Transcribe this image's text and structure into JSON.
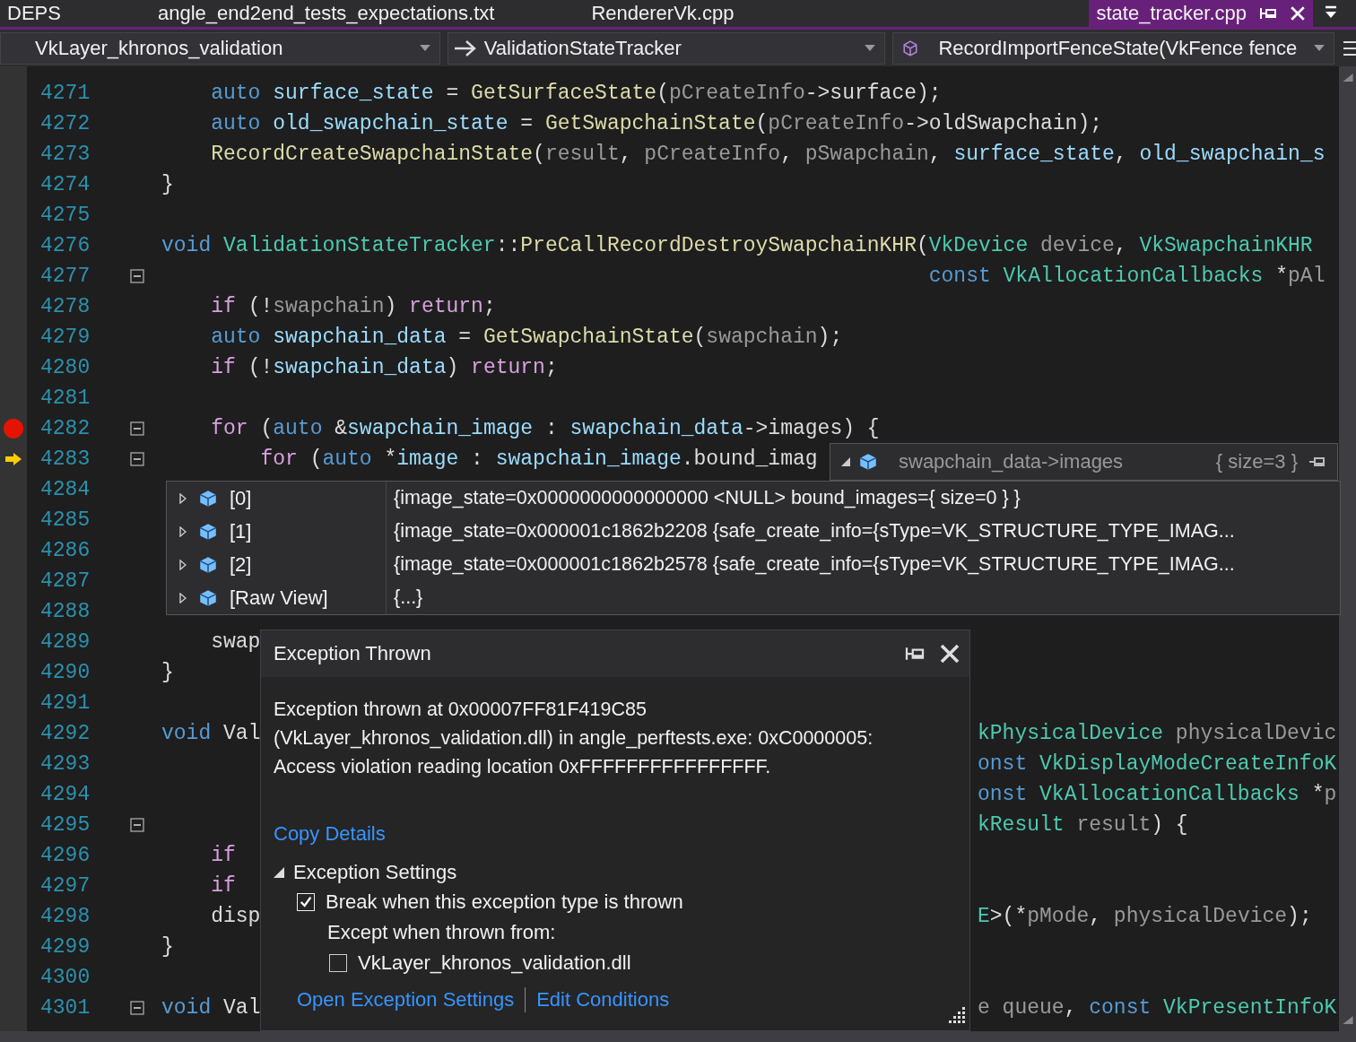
{
  "tabs": [
    {
      "label": "DEPS",
      "selected": false
    },
    {
      "label": "angle_end2end_tests_expectations.txt",
      "selected": false
    },
    {
      "label": "RendererVk.cpp",
      "selected": false
    },
    {
      "label": "state_tracker.cpp",
      "selected": true
    }
  ],
  "navigation": {
    "project": "VkLayer_khronos_validation",
    "scope": "ValidationStateTracker",
    "member": "RecordImportFenceState(VkFence fence"
  },
  "code_lines": [
    {
      "number": "4271",
      "fold": false,
      "code": [
        {
          "kind": "k",
          "text": "    auto"
        },
        {
          "kind": "v",
          "text": " surface_state"
        },
        {
          "kind": "o",
          "text": " = "
        },
        {
          "kind": "f",
          "text": "GetSurfaceState"
        },
        {
          "kind": "o",
          "text": "("
        },
        {
          "kind": "p",
          "text": "pCreateInfo"
        },
        {
          "kind": "o",
          "text": "->surface);"
        }
      ]
    },
    {
      "number": "4272",
      "fold": false,
      "code": [
        {
          "kind": "k",
          "text": "    auto"
        },
        {
          "kind": "v",
          "text": " old_swapchain_state"
        },
        {
          "kind": "o",
          "text": " = "
        },
        {
          "kind": "f",
          "text": "GetSwapchainState"
        },
        {
          "kind": "o",
          "text": "("
        },
        {
          "kind": "p",
          "text": "pCreateInfo"
        },
        {
          "kind": "o",
          "text": "->oldSwapchain);"
        }
      ]
    },
    {
      "number": "4273",
      "fold": false,
      "code": [
        {
          "kind": "f",
          "text": "    RecordCreateSwapchainState"
        },
        {
          "kind": "o",
          "text": "("
        },
        {
          "kind": "p",
          "text": "result"
        },
        {
          "kind": "o",
          "text": ", "
        },
        {
          "kind": "p",
          "text": "pCreateInfo"
        },
        {
          "kind": "o",
          "text": ", "
        },
        {
          "kind": "p",
          "text": "pSwapchain"
        },
        {
          "kind": "o",
          "text": ", "
        },
        {
          "kind": "v",
          "text": "surface_state"
        },
        {
          "kind": "o",
          "text": ", "
        },
        {
          "kind": "v",
          "text": "old_swapchain_s"
        }
      ]
    },
    {
      "number": "4274",
      "fold": false,
      "code": [
        {
          "kind": "o",
          "text": "}"
        }
      ]
    },
    {
      "number": "4275",
      "fold": false
    },
    {
      "number": "4276",
      "fold": false,
      "code": [
        {
          "kind": "k",
          "text": "void"
        },
        {
          "kind": "t",
          "text": " ValidationStateTracker"
        },
        {
          "kind": "o",
          "text": "::"
        },
        {
          "kind": "f",
          "text": "PreCallRecordDestroySwapchainKHR"
        },
        {
          "kind": "o",
          "text": "("
        },
        {
          "kind": "t",
          "text": "VkDevice"
        },
        {
          "kind": "p",
          "text": " device"
        },
        {
          "kind": "o",
          "text": ", "
        },
        {
          "kind": "t",
          "text": "VkSwapchainKHR"
        }
      ]
    },
    {
      "number": "4277",
      "fold": true,
      "code": [
        {
          "kind": "k",
          "text": "                                                              const"
        },
        {
          "kind": "t",
          "text": " VkAllocationCallbacks"
        },
        {
          "kind": "o",
          "text": " *"
        },
        {
          "kind": "p",
          "text": "pAl"
        }
      ]
    },
    {
      "number": "4278",
      "fold": false,
      "code": [
        {
          "kind": "c",
          "text": "    if"
        },
        {
          "kind": "o",
          "text": " (!"
        },
        {
          "kind": "p",
          "text": "swapchain"
        },
        {
          "kind": "o",
          "text": ") "
        },
        {
          "kind": "c",
          "text": "return"
        },
        {
          "kind": "o",
          "text": ";"
        }
      ]
    },
    {
      "number": "4279",
      "fold": false,
      "code": [
        {
          "kind": "k",
          "text": "    auto"
        },
        {
          "kind": "v",
          "text": " swapchain_data"
        },
        {
          "kind": "o",
          "text": " = "
        },
        {
          "kind": "f",
          "text": "GetSwapchainState"
        },
        {
          "kind": "o",
          "text": "("
        },
        {
          "kind": "p",
          "text": "swapchain"
        },
        {
          "kind": "o",
          "text": ");"
        }
      ]
    },
    {
      "number": "4280",
      "fold": false,
      "code": [
        {
          "kind": "c",
          "text": "    if"
        },
        {
          "kind": "o",
          "text": " (!"
        },
        {
          "kind": "v",
          "text": "swapchain_data"
        },
        {
          "kind": "o",
          "text": ") "
        },
        {
          "kind": "c",
          "text": "return"
        },
        {
          "kind": "o",
          "text": ";"
        }
      ]
    },
    {
      "number": "4281",
      "fold": false
    },
    {
      "number": "4282",
      "fold": true,
      "breakpoint": true,
      "code": [
        {
          "kind": "c",
          "text": "    for"
        },
        {
          "kind": "o",
          "text": " ("
        },
        {
          "kind": "k",
          "text": "auto"
        },
        {
          "kind": "o",
          "text": " &"
        },
        {
          "kind": "v",
          "text": "swapchain_image"
        },
        {
          "kind": "o",
          "text": " : "
        },
        {
          "kind": "v",
          "text": "swapchain_data"
        },
        {
          "kind": "o",
          "text": "->images) {"
        }
      ]
    },
    {
      "number": "4283",
      "fold": true,
      "current": true,
      "code": [
        {
          "kind": "c",
          "text": "        for"
        },
        {
          "kind": "o",
          "text": " ("
        },
        {
          "kind": "k",
          "text": "auto"
        },
        {
          "kind": "o",
          "text": " *"
        },
        {
          "kind": "v",
          "text": "image"
        },
        {
          "kind": "o",
          "text": " : "
        },
        {
          "kind": "v",
          "text": "swapchain_image"
        },
        {
          "kind": "o",
          "text": ".bound_imag"
        }
      ]
    },
    {
      "number": "4284",
      "fold": false
    },
    {
      "number": "4285",
      "fold": false
    },
    {
      "number": "4286",
      "fold": false
    },
    {
      "number": "4287",
      "fold": false
    },
    {
      "number": "4288",
      "fold": false
    },
    {
      "number": "4289",
      "fold": false,
      "code": [
        {
          "kind": "o",
          "text": "    swap"
        }
      ]
    },
    {
      "number": "4290",
      "fold": false,
      "code": [
        {
          "kind": "o",
          "text": "}"
        }
      ]
    },
    {
      "number": "4291",
      "fold": false
    },
    {
      "number": "4292",
      "fold": false,
      "code": [
        {
          "kind": "k",
          "text": "void"
        },
        {
          "kind": "o",
          "text": " Val"
        }
      ],
      "right": [
        {
          "kind": "t",
          "text": "kPhysicalDevice"
        },
        {
          "kind": "p",
          "text": " physicalDevic"
        }
      ]
    },
    {
      "number": "4293",
      "fold": false,
      "right": [
        {
          "kind": "k",
          "text": "onst"
        },
        {
          "kind": "t",
          "text": " VkDisplayModeCreateInfoK"
        }
      ]
    },
    {
      "number": "4294",
      "fold": false,
      "right": [
        {
          "kind": "k",
          "text": "onst"
        },
        {
          "kind": "t",
          "text": " VkAllocationCallbacks"
        },
        {
          "kind": "o",
          "text": " *"
        },
        {
          "kind": "p",
          "text": "p"
        }
      ]
    },
    {
      "number": "4295",
      "fold": true,
      "right": [
        {
          "kind": "t",
          "text": "kResult"
        },
        {
          "kind": "p",
          "text": " result"
        },
        {
          "kind": "o",
          "text": ") {"
        }
      ]
    },
    {
      "number": "4296",
      "fold": false,
      "code": [
        {
          "kind": "c",
          "text": "    if"
        }
      ]
    },
    {
      "number": "4297",
      "fold": false,
      "code": [
        {
          "kind": "c",
          "text": "    if"
        }
      ]
    },
    {
      "number": "4298",
      "fold": false,
      "code": [
        {
          "kind": "o",
          "text": "    disp"
        }
      ],
      "right": [
        {
          "kind": "t",
          "text": "E"
        },
        {
          "kind": "o",
          "text": ">(*"
        },
        {
          "kind": "p",
          "text": "pMode"
        },
        {
          "kind": "o",
          "text": ", "
        },
        {
          "kind": "p",
          "text": "physicalDevice"
        },
        {
          "kind": "o",
          "text": ");"
        }
      ]
    },
    {
      "number": "4299",
      "fold": false,
      "code": [
        {
          "kind": "o",
          "text": "}"
        }
      ]
    },
    {
      "number": "4300",
      "fold": false
    },
    {
      "number": "4301",
      "fold": true,
      "code": [
        {
          "kind": "k",
          "text": "void"
        },
        {
          "kind": "o",
          "text": " Val"
        }
      ],
      "right": [
        {
          "kind": "p",
          "text": "e queue"
        },
        {
          "kind": "o",
          "text": ", "
        },
        {
          "kind": "k",
          "text": "const"
        },
        {
          "kind": "t",
          "text": " VkPresentInfoK"
        }
      ]
    }
  ],
  "datatip": {
    "expression": "swapchain_data->images",
    "summary": "{ size=3 }",
    "expanded": true,
    "rows": [
      {
        "name": "[0]",
        "value": "{image_state=0x0000000000000000 <NULL> bound_images={ size=0 } }",
        "expanded": false
      },
      {
        "name": "[1]",
        "value": "{image_state=0x000001c1862b2208 {safe_create_info={sType=VK_STRUCTURE_TYPE_IMAG...",
        "expanded": false
      },
      {
        "name": "[2]",
        "value": "{image_state=0x000001c1862b2578 {safe_create_info={sType=VK_STRUCTURE_TYPE_IMAG...",
        "expanded": false
      },
      {
        "name": "[Raw View]",
        "value": "{...}",
        "expanded": false
      }
    ]
  },
  "exception": {
    "title": "Exception Thrown",
    "message": "Exception thrown at 0x00007FF81F419C85\n(VkLayer_khronos_validation.dll) in angle_perftests.exe: 0xC0000005:\nAccess violation reading location 0xFFFFFFFFFFFFFFFF.",
    "copy_link": "Copy Details",
    "settings": {
      "title": "Exception Settings",
      "expanded": true,
      "break_option": {
        "label": "Break when this exception type is thrown",
        "checked": true
      },
      "except_label": "Except when thrown from:",
      "modules": [
        {
          "label": "VkLayer_khronos_validation.dll",
          "checked": false
        }
      ]
    },
    "links": [
      "Open Exception Settings",
      "Edit Conditions"
    ]
  }
}
